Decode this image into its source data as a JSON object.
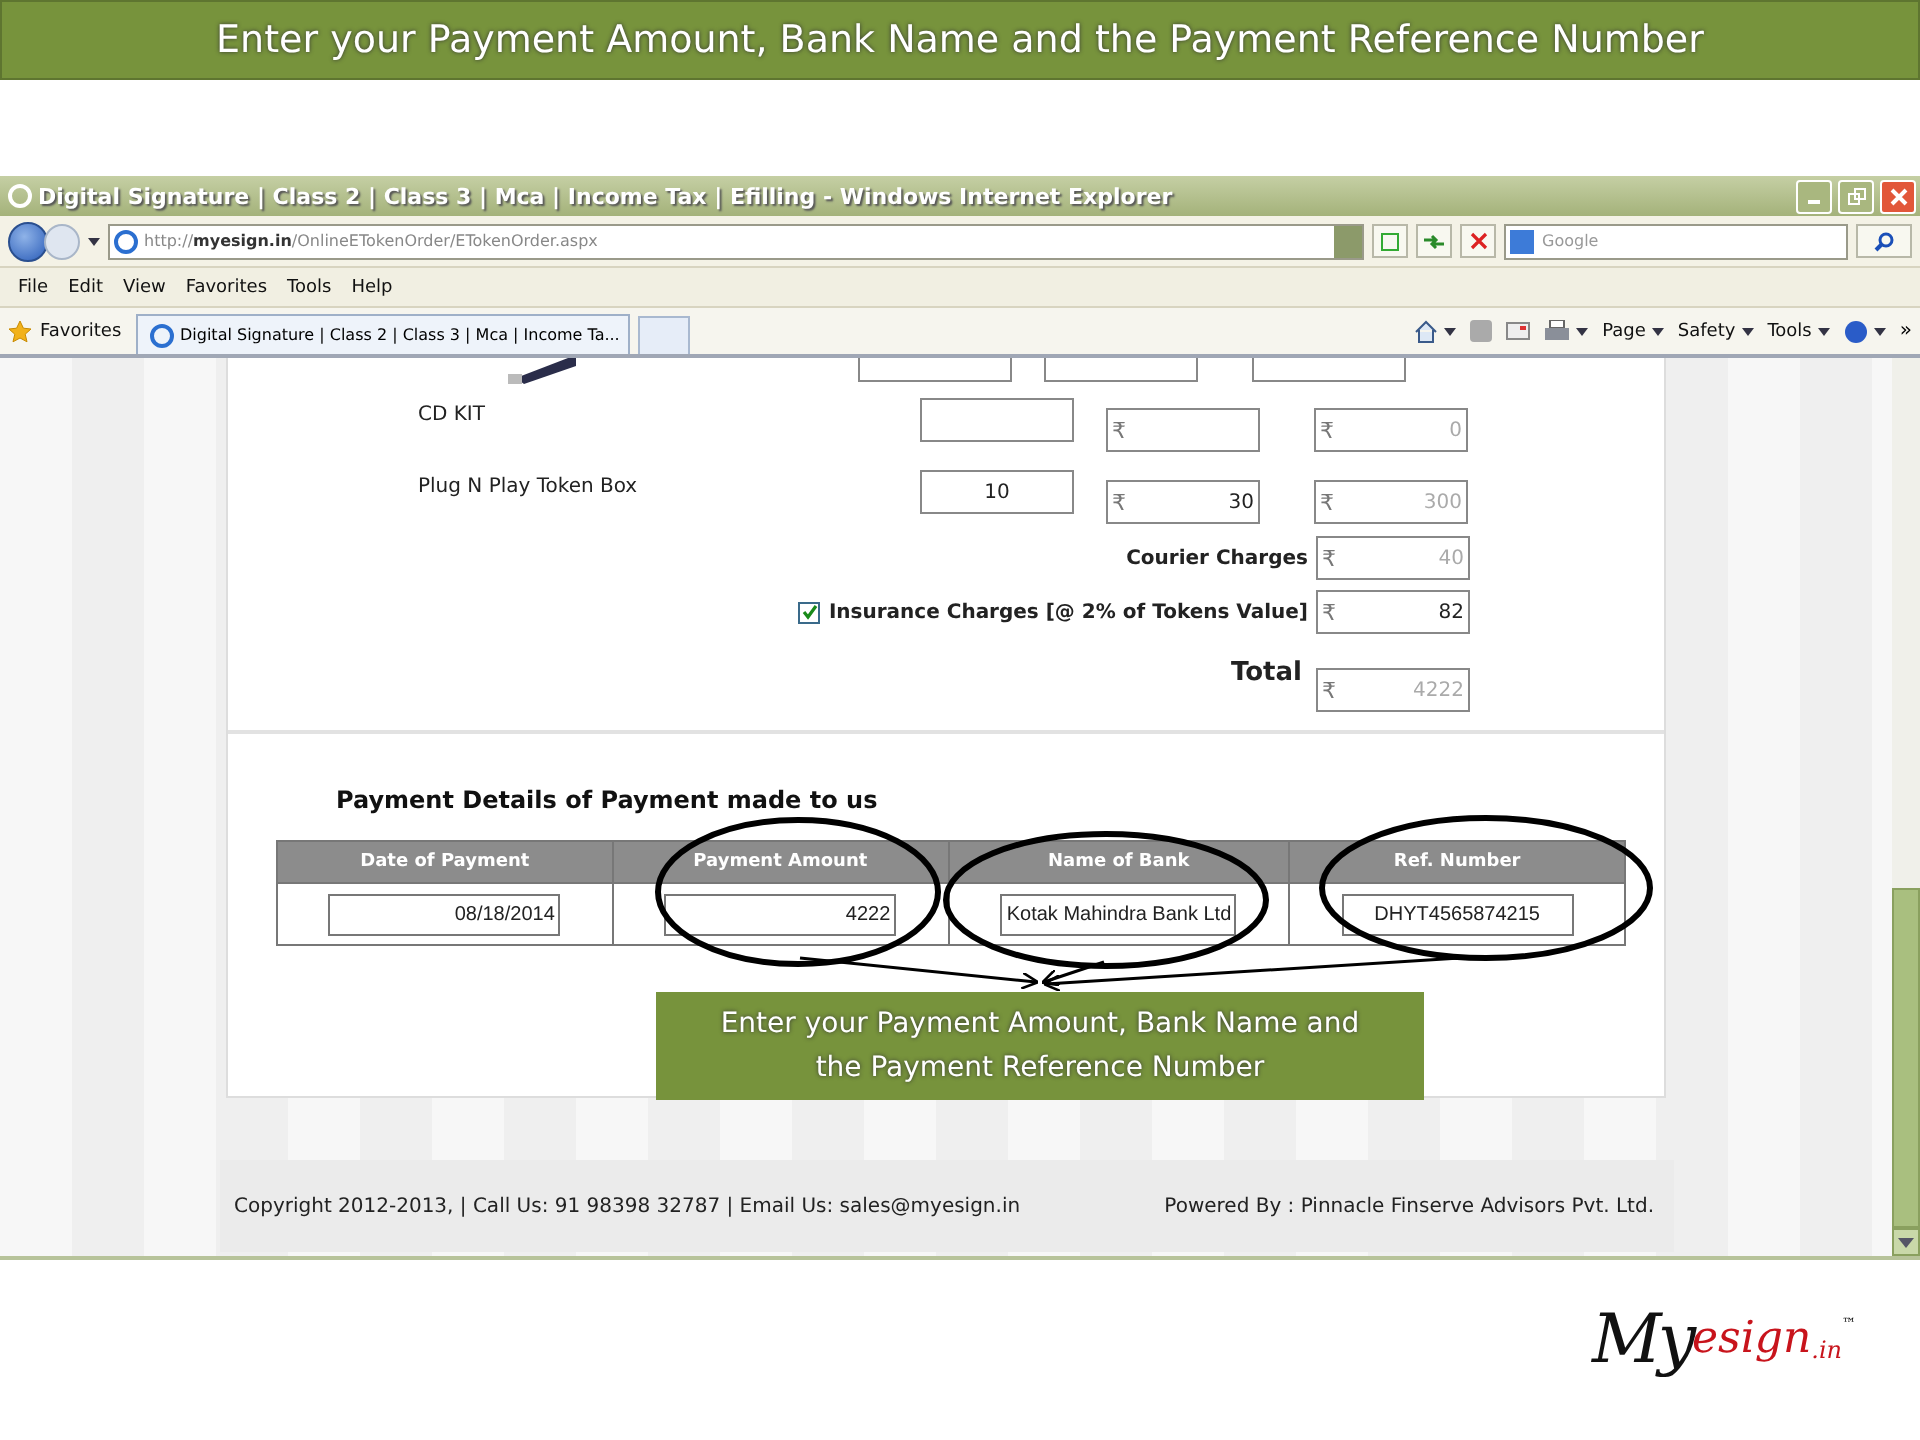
{
  "slide_banner": "Enter your Payment Amount, Bank Name and the Payment Reference Number",
  "browser": {
    "title": "Digital Signature | Class 2 | Class 3 | Mca | Income Tax | Efilling - Windows Internet Explorer",
    "address": {
      "scheme": "http://",
      "host": "myesign.in",
      "path": "/OnlineETokenOrder/ETokenOrder.aspx"
    },
    "search_placeholder": "Google",
    "menu": [
      "File",
      "Edit",
      "View",
      "Favorites",
      "Tools",
      "Help"
    ],
    "favorites_label": "Favorites",
    "tab_title": "Digital Signature | Class 2 | Class 3 | Mca | Income Ta...",
    "commands": [
      "Page",
      "Safety",
      "Tools"
    ],
    "more": "»"
  },
  "order": {
    "currency": "₹",
    "items": [
      {
        "name": "CD KIT",
        "amount": "0"
      },
      {
        "name": "Plug N Play Token Box",
        "quantity": "10",
        "price": "30",
        "amount": "300"
      }
    ],
    "charges": [
      {
        "kind": "plain",
        "label": "Courier Charges",
        "amount": "40"
      },
      {
        "kind": "checkbox",
        "label": "Insurance Charges [@ 2% of Tokens Value]",
        "checked": true,
        "amount": "82"
      }
    ],
    "total_label": "Total",
    "total": "4222"
  },
  "payment": {
    "title": "Payment Details of Payment made to us",
    "columns": [
      "Date of Payment",
      "Payment Amount",
      "Name of Bank",
      "Ref. Number"
    ],
    "values": [
      "08/18/2014",
      "4222",
      "Kotak Mahindra Bank Ltd",
      "DHYT4565874215"
    ]
  },
  "callout": [
    "Enter your Payment Amount, Bank Name and",
    "the Payment Reference Number"
  ],
  "footer": {
    "left": "Copyright 2012-2013, | Call Us: 91 98398 32787 | Email Us: sales@myesign.in",
    "right": "Powered By : Pinnacle Finserve Advisors Pvt. Ltd."
  },
  "logo": {
    "my": "My",
    "esign": "esign",
    "tld": ".in",
    "tm": "™"
  }
}
